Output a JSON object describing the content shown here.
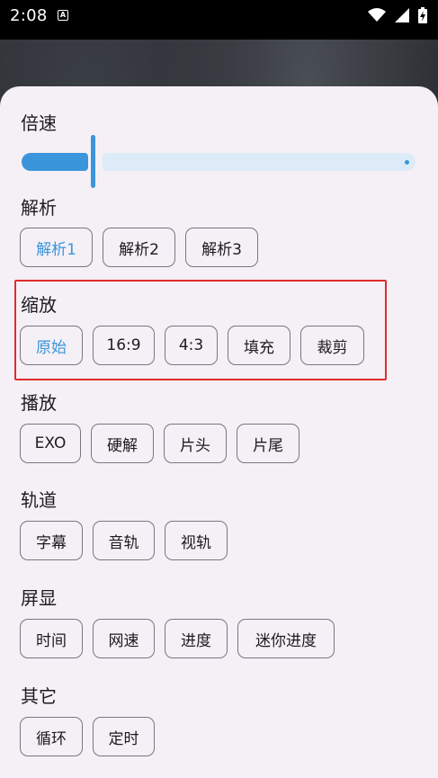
{
  "status": {
    "time": "2:08"
  },
  "sections": {
    "speed": {
      "title": "倍速",
      "slider_value_fraction": 0.18
    },
    "parse": {
      "title": "解析",
      "options": [
        "解析1",
        "解析2",
        "解析3"
      ]
    },
    "scale": {
      "title": "缩放",
      "options": [
        "原始",
        "16:9",
        "4:3",
        "填充",
        "裁剪"
      ]
    },
    "play": {
      "title": "播放",
      "options": [
        "EXO",
        "硬解",
        "片头",
        "片尾"
      ]
    },
    "track": {
      "title": "轨道",
      "options": [
        "字幕",
        "音轨",
        "视轨"
      ]
    },
    "display": {
      "title": "屏显",
      "options": [
        "时间",
        "网速",
        "进度",
        "迷你进度"
      ]
    },
    "other": {
      "title": "其它",
      "options": [
        "循环",
        "定时"
      ]
    }
  },
  "accent_color": "#3a95db",
  "highlight_color": "#e02b2b"
}
